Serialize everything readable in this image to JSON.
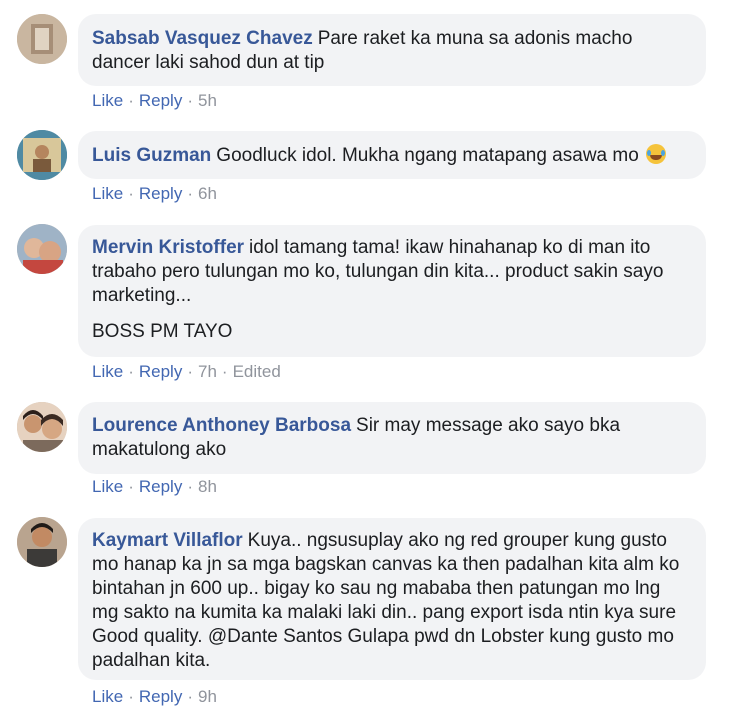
{
  "comments": [
    {
      "author": "Sabsab Vasquez Chavez",
      "text": "Pare raket ka muna sa adonis macho dancer laki sahod dun at tip",
      "like": "Like",
      "reply": "Reply",
      "time": "5h"
    },
    {
      "author": "Luis Guzman",
      "text": "Goodluck idol. Mukha ngang matapang asawa mo",
      "emoji": "rofl-emoji",
      "like": "Like",
      "reply": "Reply",
      "time": "6h"
    },
    {
      "author": "Mervin Kristoffer",
      "text": "idol tamang tama! ikaw hinahanap ko di man ito trabaho pero tulungan mo ko, tulungan din kita... product sakin sayo marketing...",
      "text2": "BOSS PM TAYO",
      "like": "Like",
      "reply": "Reply",
      "time": "7h",
      "edited": "Edited"
    },
    {
      "author": "Lourence Anthoney Barbosa",
      "text": "Sir may message ako sayo bka makatulong ako",
      "like": "Like",
      "reply": "Reply",
      "time": "8h"
    },
    {
      "author": "Kaymart Villaflor",
      "text": "Kuya.. ngsusuplay ako ng red grouper kung gusto mo hanap ka jn sa mga bagskan canvas ka then padalhan kita alm ko bintahan jn 600 up.. bigay ko sau ng mababa then patungan mo lng mg sakto na kumita ka malaki laki din.. pang export isda ntin kya sure Good quality. @Dante Santos Gulapa pwd dn Lobster kung gusto mo padalhan kita.",
      "like": "Like",
      "reply": "Reply",
      "time": "9h"
    }
  ],
  "colors": {
    "author": "#385898",
    "action_link": "#4267b2",
    "meta": "#90949c",
    "bubble_bg": "#f2f3f5"
  },
  "separator": "·"
}
